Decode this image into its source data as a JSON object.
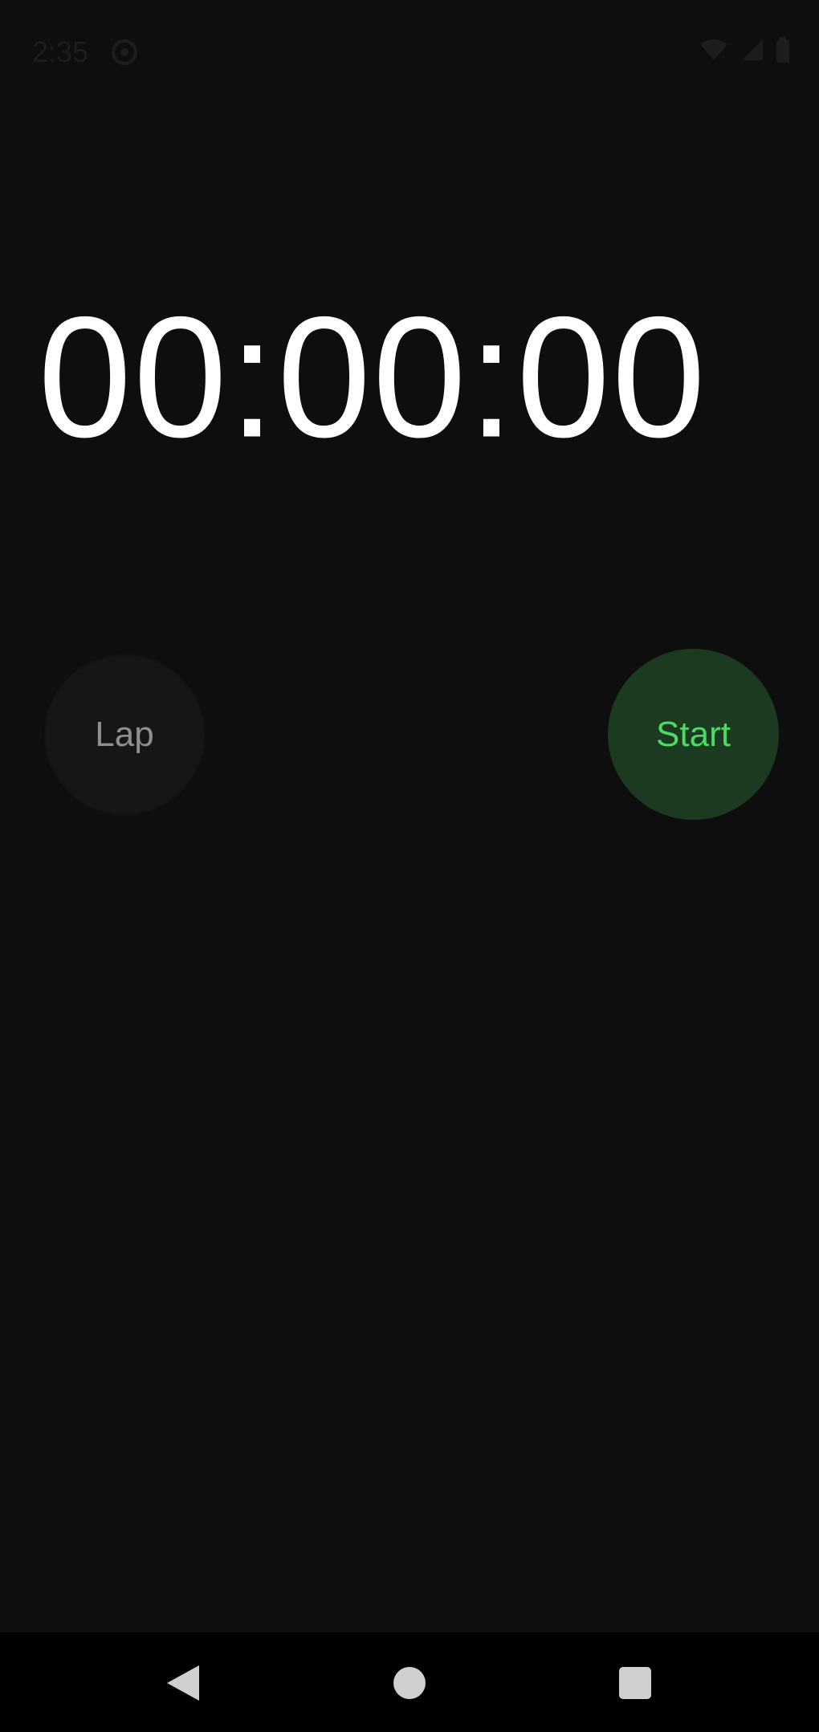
{
  "status_bar": {
    "time": "2:35",
    "icons": [
      "notification-icon",
      "wifi-icon",
      "signal-icon",
      "battery-icon"
    ]
  },
  "stopwatch": {
    "time_display": "00:00:00"
  },
  "buttons": {
    "lap_label": "Lap",
    "start_label": "Start"
  },
  "nav_bar": {
    "icons": [
      "back-icon",
      "home-icon",
      "recents-icon"
    ]
  },
  "colors": {
    "background": "#0e0e0f",
    "timer_text": "#ffffff",
    "lap_button_bg": "#161617",
    "lap_button_text": "#8f8f92",
    "start_button_bg": "#1b3a1f",
    "start_button_text": "#4cd964",
    "nav_bar_bg": "#000000",
    "nav_icon": "#d0d0d0"
  }
}
